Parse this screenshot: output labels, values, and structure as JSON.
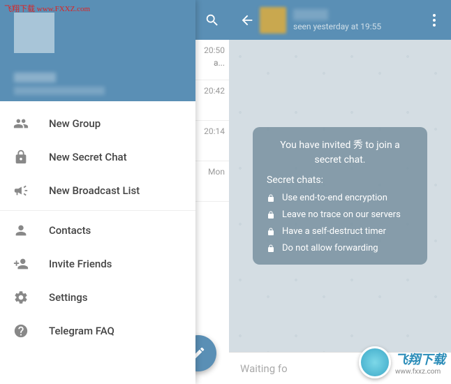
{
  "watermark": {
    "top_left": "飞翔下载 www.FXXZ.com",
    "bottom_right_cn": "飞翔下载",
    "bottom_right_url": "www.fxxz.com"
  },
  "drawer": {
    "menu1": [
      {
        "icon": "group",
        "label": "New Group"
      },
      {
        "icon": "lock",
        "label": "New Secret Chat"
      },
      {
        "icon": "megaphone",
        "label": "New Broadcast List"
      }
    ],
    "menu2": [
      {
        "icon": "person",
        "label": "Contacts"
      },
      {
        "icon": "person-add",
        "label": "Invite Friends"
      },
      {
        "icon": "gear",
        "label": "Settings"
      },
      {
        "icon": "help",
        "label": "Telegram FAQ"
      }
    ]
  },
  "chat_list": [
    {
      "time": "20:50",
      "preview": "a..."
    },
    {
      "time": "20:42",
      "preview": ""
    },
    {
      "time": "20:14",
      "preview": ""
    },
    {
      "time": "Mon",
      "preview": ""
    }
  ],
  "chat": {
    "status_prefix": "seen yesterday at ",
    "status_time": "19:55",
    "invite_text_1": "You have invited 秀 to join a",
    "invite_text_2": "secret chat.",
    "section_title": "Secret chats:",
    "features": [
      "Use end-to-end encryption",
      "Leave no trace on our servers",
      "Have a self-destruct timer",
      "Do not allow forwarding"
    ],
    "input_placeholder": "Waiting fo"
  }
}
